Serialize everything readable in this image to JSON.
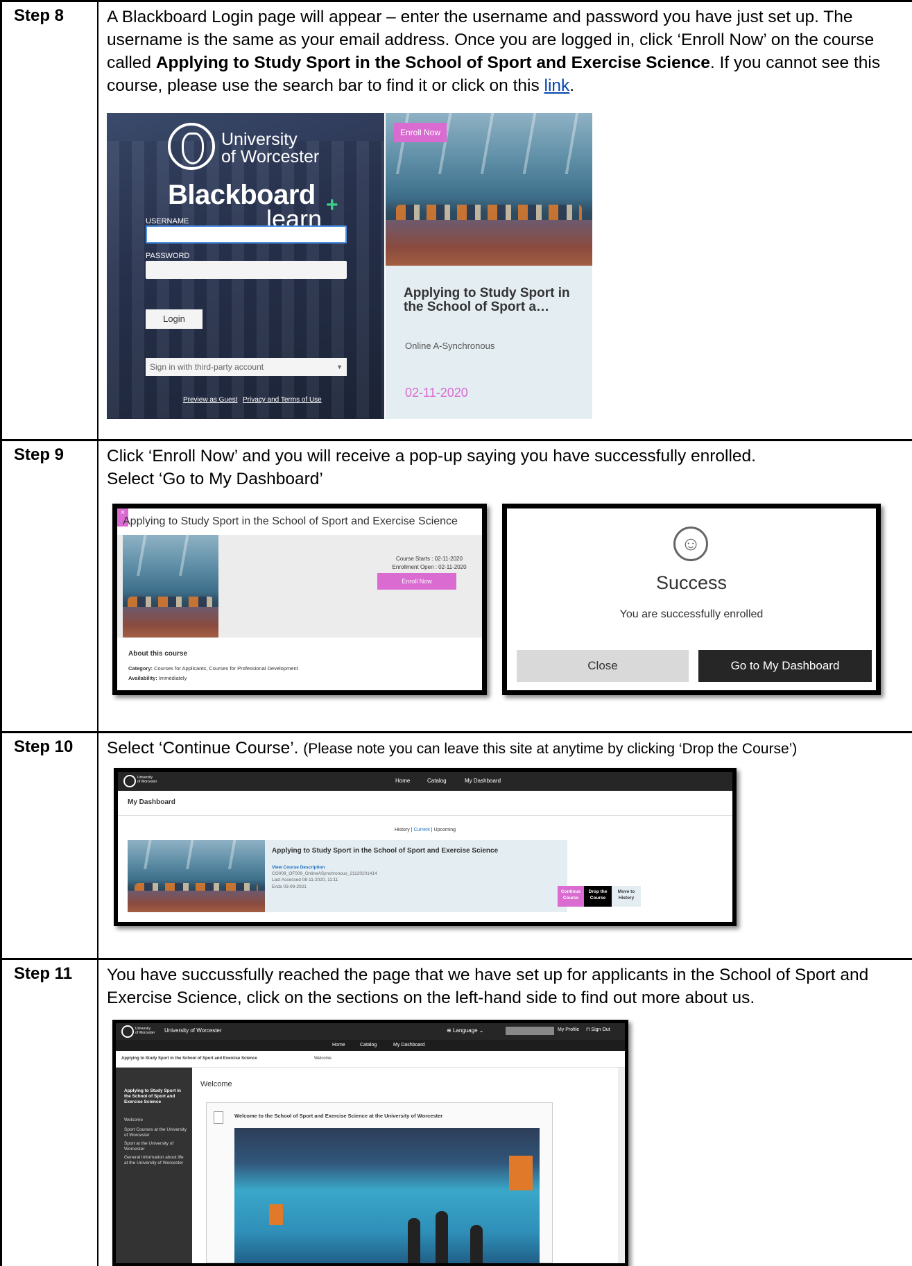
{
  "steps": [
    {
      "label": "Step 8",
      "text_parts": {
        "p1": "A Blackboard Login page will appear – enter the username and password you have just set up. The username is the same as your email address.  Once you are logged in, click ‘Enroll Now’ on the course called ",
        "bold": "Applying to Study Sport in the School of Sport and Exercise Science",
        "p2": ".  If you cannot see this course, please use the search bar to find it or click on this ",
        "link": "link",
        "p3": "."
      }
    },
    {
      "label": "Step 9",
      "line1": "Click ‘Enroll Now’ and you will receive a pop-up saying you have successfully enrolled.",
      "line2": "Select ‘Go to My Dashboard’"
    },
    {
      "label": "Step 10",
      "main": "Select ‘Continue Course’. ",
      "note": " (Please note you can leave this site at anytime by clicking ‘Drop the Course’)"
    },
    {
      "label": "Step 11",
      "text": "You have succussfully reached the page that we have set up for applicants in the School of Sport and Exercise Science, click on the sections on the left-hand side to find out more about us."
    }
  ],
  "login": {
    "uni_line1": "University",
    "uni_line2": "of Worcester",
    "brand": "Blackboard",
    "brand_sub": "learn",
    "username_label": "USERNAME",
    "password_label": "PASSWORD",
    "login_button": "Login",
    "third_party": "Sign in with third-party account",
    "footer_guest": "Preview as Guest",
    "footer_privacy": "Privacy and Terms of Use"
  },
  "course_card": {
    "badge": "Enroll Now",
    "title": "Applying to Study Sport in the School of Sport a…",
    "mode": "Online A-Synchronous",
    "date": "02-11-2020"
  },
  "enroll_popup": {
    "close_x": "×",
    "title": "Applying to Study Sport in the School of Sport and Exercise Science",
    "starts": "Course Starts : 02-11-2020",
    "open": "Enrollment Open : 02-11-2020",
    "enroll": "Enroll Now",
    "about": "About this course",
    "category_label": "Category:",
    "category": " Courses for Applicants, Courses for Professional Development",
    "availability_label": "Availability:",
    "availability": " Immediately"
  },
  "success_popup": {
    "icon": "☺",
    "title": "Success",
    "message": "You are successfully enrolled",
    "close": "Close",
    "go": "Go to My Dashboard"
  },
  "dashboard": {
    "logo_text1": "University",
    "logo_text2": "of Worcester",
    "nav": [
      "Home",
      "Catalog",
      "My Dashboard"
    ],
    "heading": "My Dashboard",
    "tab_history": "History",
    "tab_current": "Current",
    "tab_upcoming": "Upcoming",
    "sep": " | ",
    "course_title": "Applying to Study Sport in the School of Sport and Exercise Science",
    "view_desc": "View Course Description",
    "code": "CO009_OF009_OnlineASynchronous_21120201414",
    "last_accessed": "Last Accessed 08-11-2020, 11:11",
    "ends": "Ends 03-09-2021",
    "btn_continue_1": "Continue",
    "btn_continue_2": "Course",
    "btn_drop_1": "Drop the",
    "btn_drop_2": "Course",
    "btn_move_1": "Move to",
    "btn_move_2": "History"
  },
  "course_page": {
    "site": "University of Worcester",
    "language": "Language",
    "profile": "My Profile",
    "signout": "Sign Out",
    "nav": [
      "Home",
      "Catalog",
      "My Dashboard"
    ],
    "crumb_course": "Applying to Study Sport in the School of Sport and Exercise Science",
    "crumb_page": "Welcome",
    "side_title": "Applying to Study Sport in the School of Sport and Exercise Science",
    "side_items": [
      "Welcome",
      "Sport Courses at the University of Worcester",
      "Sport at the University of Worcester",
      "General Information about life at the University of Worcester"
    ],
    "page_title": "Welcome",
    "item_title": "Welcome to the School of Sport and Exercise Science at the University of Worcester"
  },
  "colors": {
    "accent_pink": "#d96bd1",
    "link_blue": "#0645ad",
    "dark": "#262626"
  }
}
